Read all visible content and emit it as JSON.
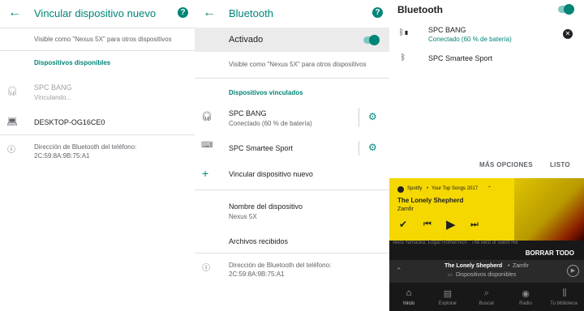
{
  "pane1": {
    "title": "Vincular dispositivo nuevo",
    "visible_text": "Visible como \"Nexus 5X\" para otros dispositivos",
    "section": "Dispositivos disponibles",
    "devices": [
      {
        "name": "SPC BANG",
        "status": "Vinculando..."
      },
      {
        "name": "DESKTOP-OG16CE0",
        "status": ""
      }
    ],
    "address": "Dirección de Bluetooth del teléfono: 2C:59:8A:9B:75:A1"
  },
  "pane2": {
    "title": "Bluetooth",
    "toggle_label": "Activado",
    "visible_text": "Visible como \"Nexus 5X\" para otros dispositivos",
    "section": "Dispositivos vinculados",
    "devices": [
      {
        "name": "SPC BANG",
        "status": "Conectado (60 % de batería)"
      },
      {
        "name": "SPC Smartee Sport",
        "status": ""
      }
    ],
    "pair_new": "Vincular dispositivo nuevo",
    "device_name_label": "Nombre del dispositivo",
    "device_name_value": "Nexus 5X",
    "received_files": "Archivos recibidos",
    "address": "Dirección de Bluetooth del teléfono: 2C:59:8A:9B:75:A1"
  },
  "pane3": {
    "title": "Bluetooth",
    "devices": [
      {
        "name": "SPC BANG",
        "status": "Conectado (60 % de batería)"
      },
      {
        "name": "SPC Smartee Sport",
        "status": ""
      }
    ],
    "more_options": "MÁS OPCIONES",
    "done": "LISTO",
    "notification": {
      "app": "Spotify",
      "context": "Your Top Songs 2017",
      "song": "The Lonely Shepherd",
      "artist": "Zamfir"
    },
    "artists_strip": "Akira Yamaoka, Edgar Rothermich · The Best of Silent Hill",
    "clear_all": "BORRAR TODO",
    "player": {
      "song": "The Lonely Shepherd",
      "artist": "Zamfir",
      "devices": "Dispositivos disponibles"
    },
    "nav": [
      "Inicio",
      "Explorar",
      "Buscar",
      "Radio",
      "Tu biblioteca"
    ]
  },
  "colors": {
    "accent": "#008577",
    "spotify_yellow": "#f5d800"
  }
}
